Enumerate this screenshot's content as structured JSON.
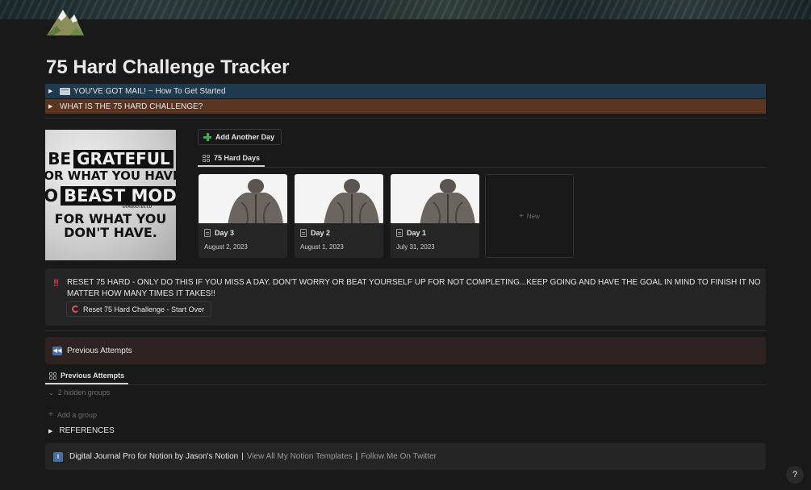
{
  "page": {
    "title": "75 Hard Challenge Tracker"
  },
  "toggles": {
    "mail": "YOU'VE GOT MAIL! ~ How To Get Started",
    "what_is": "WHAT IS THE 75 HARD CHALLENGE?"
  },
  "poster": {
    "line1a": "BE",
    "line1b": "GRATEFUL",
    "line2": "FOR WHAT YOU HAVE.",
    "line3a": "GO",
    "line3b": "BEAST MODE",
    "credit": "GYMQUOTES.CO",
    "line4": "FOR WHAT YOU",
    "line5": "DON'T HAVE."
  },
  "days": {
    "add_button": "Add Another Day",
    "view_tab": "75 Hard Days",
    "cards": [
      {
        "title": "Day 3",
        "date": "August 2, 2023"
      },
      {
        "title": "Day 2",
        "date": "August 1, 2023"
      },
      {
        "title": "Day 1",
        "date": "July 31, 2023"
      }
    ],
    "new_label": "New"
  },
  "reset": {
    "icon": "!!",
    "text": "RESET 75 HARD - ONLY DO THIS IF YOU MISS A DAY.  DON'T WORRY OR BEAT YOURSELF UP FOR NOT COMPLETING...KEEP GOING AND HAVE THE GOAL IN MIND TO FINISH IT NO MATTER HOW MANY TIMES IT TAKES!!",
    "button": "Reset 75 Hard Challenge - Start Over"
  },
  "previous": {
    "callout": "Previous Attempts",
    "view_tab": "Previous Attempts",
    "hidden_groups": "2 hidden groups",
    "add_group": "Add a group"
  },
  "references": "REFERENCES",
  "footer": {
    "brand": "Digital Journal Pro for Notion by Jason's Notion",
    "link1": "View All My Notion Templates",
    "link2": "Follow Me On Twitter",
    "separator": "|"
  },
  "help": "?",
  "colors": {
    "background": "#191919",
    "mail_bar": "#1f3a4f",
    "challenge_bar": "#5a3520",
    "previous_callout": "#2f2222",
    "add_icon": "#3fae49",
    "alert": "#e03e3e"
  }
}
